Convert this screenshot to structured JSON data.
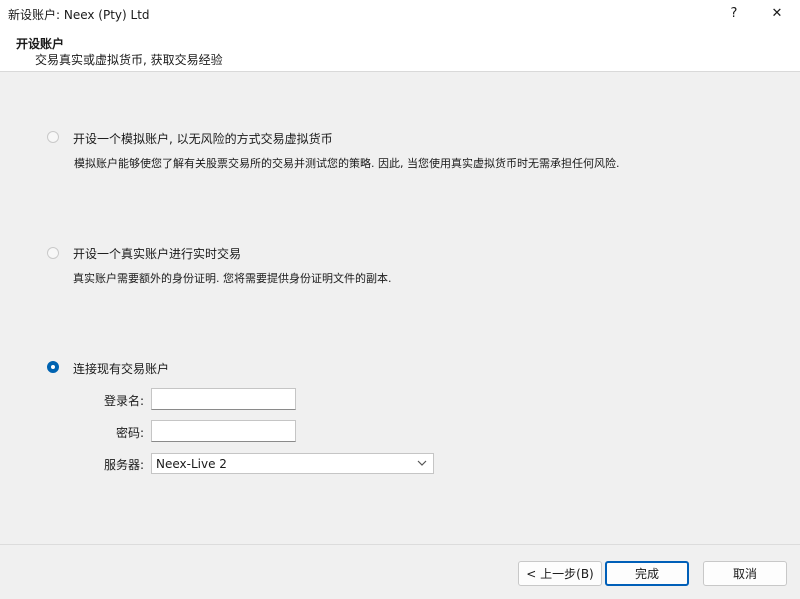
{
  "window": {
    "title": "新设账户: Neex (Pty) Ltd",
    "help_glyph": "?",
    "close_glyph": "✕"
  },
  "header": {
    "title": "开设账户",
    "subtitle": "交易真实或虚拟货币, 获取交易经验"
  },
  "options": [
    {
      "label": "开设一个模拟账户, 以无风险的方式交易虚拟货币",
      "description": "模拟账户能够使您了解有关股票交易所的交易并测试您的策略. 因此, 当您使用真实虚拟货币时无需承担任何风险.",
      "selected": false
    },
    {
      "label": "开设一个真实账户进行实时交易",
      "description": "真实账户需要额外的身份证明. 您将需要提供身份证明文件的副本.",
      "selected": false
    },
    {
      "label": "连接现有交易账户",
      "selected": true
    }
  ],
  "login_form": {
    "login_label": "登录名:",
    "login_value": "",
    "password_label": "密码:",
    "password_value": "",
    "server_label": "服务器:",
    "server_value": "Neex-Live 2"
  },
  "buttons": {
    "back": "< 上一步(B)",
    "finish": "完成",
    "cancel": "取消"
  },
  "colors": {
    "accent": "#0063b1",
    "background": "#f0f0f0"
  }
}
